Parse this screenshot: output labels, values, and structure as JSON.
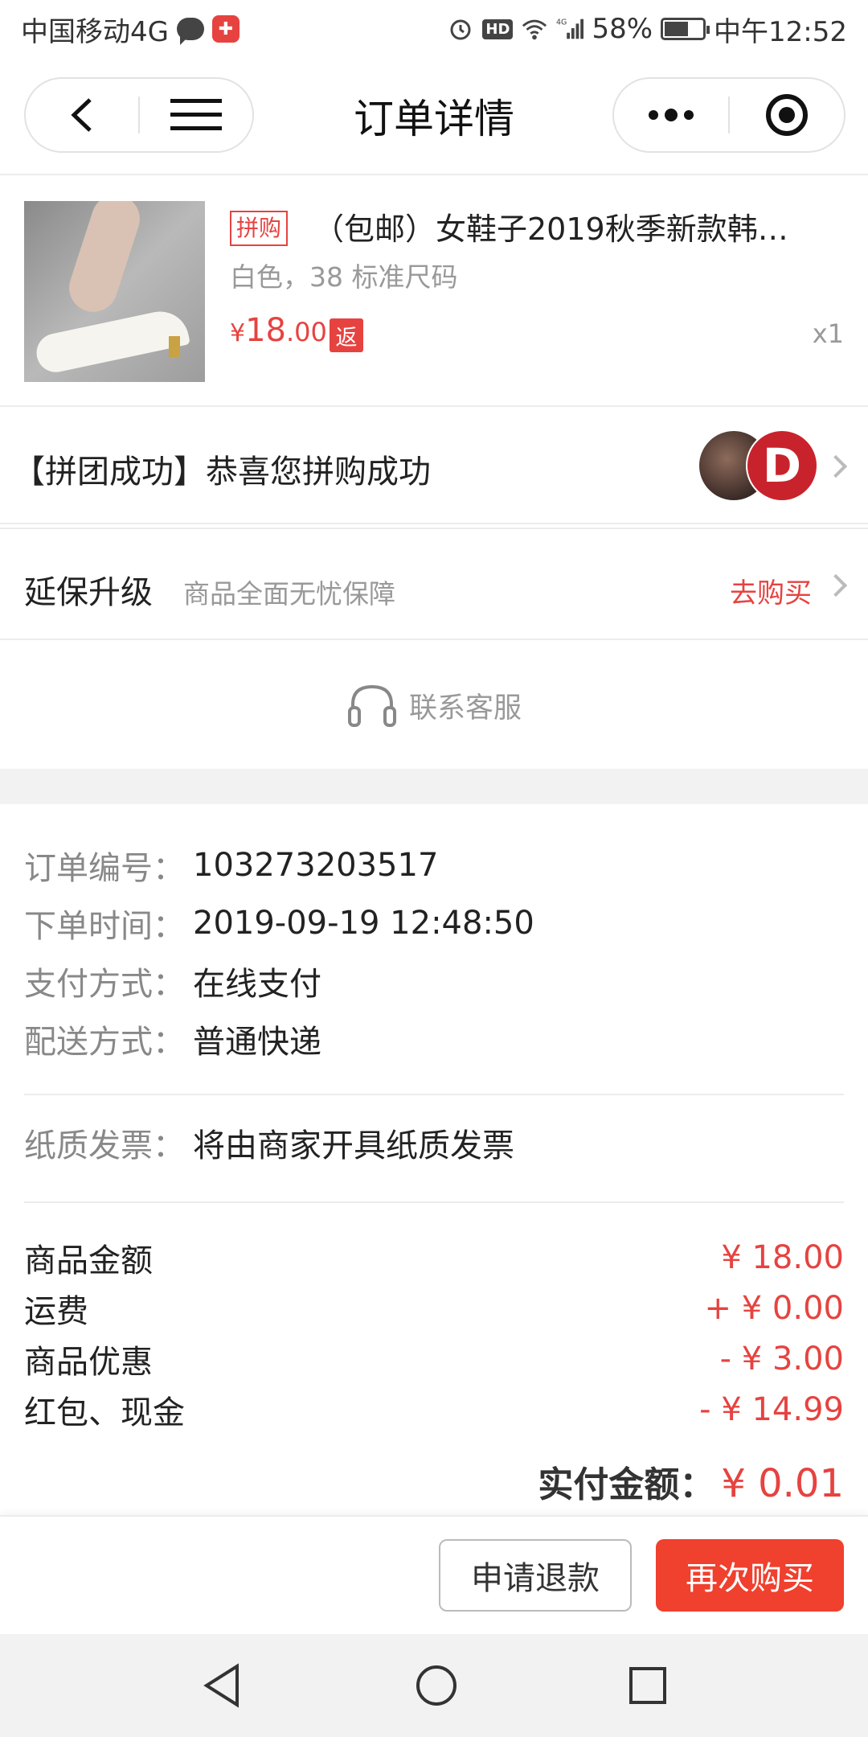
{
  "status_bar": {
    "carrier": "中国移动4G",
    "network": "4G",
    "battery": "58%",
    "time": "中午12:52"
  },
  "nav": {
    "title": "订单详情"
  },
  "product": {
    "tag": "拼购",
    "title": "（包邮）女鞋子2019秋季新款韩…",
    "spec": "白色，38 标准尺码",
    "price_currency": "¥",
    "price_int": "18",
    "price_dec": ".00",
    "rebate_tag": "返",
    "quantity": "x1"
  },
  "group": {
    "text": "【拼团成功】恭喜您拼购成功",
    "avatar_initial": "D"
  },
  "warranty": {
    "title": "延保升级",
    "subtitle": "商品全面无忧保障",
    "action": "去购买"
  },
  "service": {
    "label": "联系客服"
  },
  "order_info": [
    {
      "key": "订单编号：",
      "value": "103273203517"
    },
    {
      "key": "下单时间：",
      "value": "2019-09-19 12:48:50"
    },
    {
      "key": "支付方式：",
      "value": "在线支付"
    },
    {
      "key": "配送方式：",
      "value": "普通快递"
    }
  ],
  "invoice": {
    "key": "纸质发票：",
    "value": "将由商家开具纸质发票"
  },
  "amounts": [
    {
      "key": "商品金额",
      "value": "¥ 18.00"
    },
    {
      "key": "运费",
      "value": "+ ¥ 0.00"
    },
    {
      "key": "商品优惠",
      "value": "- ¥ 3.00"
    },
    {
      "key": "红包、现金",
      "value": "- ¥ 14.99"
    }
  ],
  "paid": {
    "key": "实付金额：",
    "value": "¥ 0.01"
  },
  "buttons": {
    "refund": "申请退款",
    "rebuy": "再次购买"
  },
  "colors": {
    "accent": "#e64340",
    "button_red": "#f0402e"
  }
}
